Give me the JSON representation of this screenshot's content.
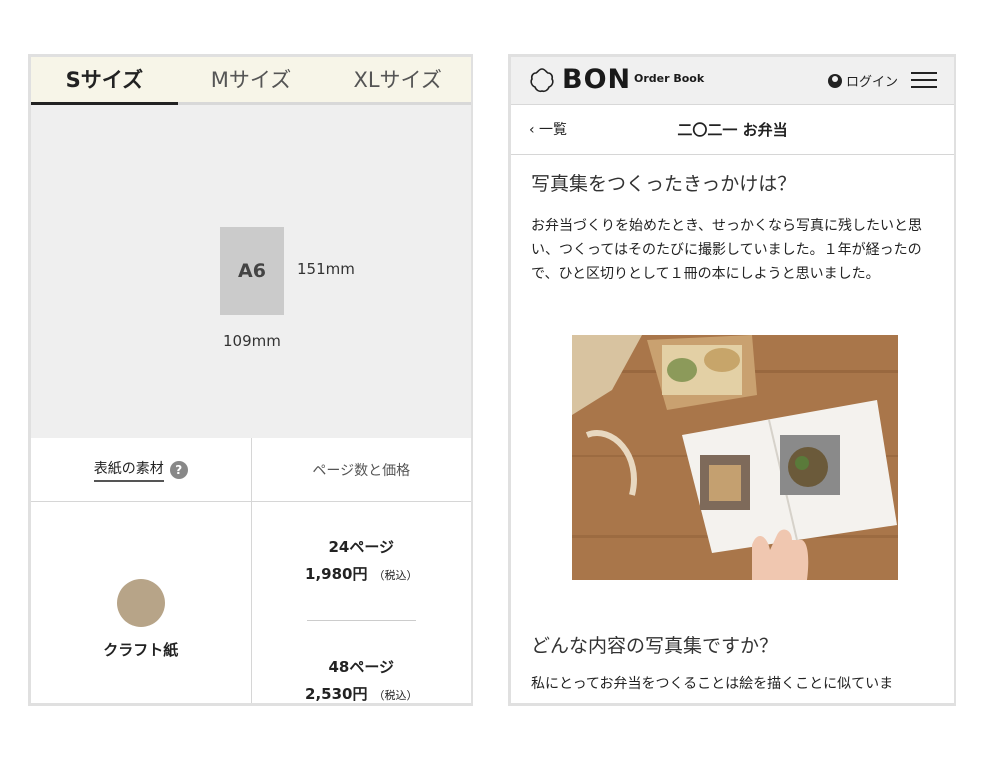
{
  "size_panel": {
    "tabs": [
      {
        "label": "Sサイズ",
        "active": true
      },
      {
        "label": "Mサイズ",
        "active": false
      },
      {
        "label": "XLサイズ",
        "active": false
      }
    ],
    "book_format": "A6",
    "height_label": "151mm",
    "width_label": "109mm",
    "cover_material_header": "表紙の素材",
    "help_icon": "?",
    "price_header": "ページ数と価格",
    "material": {
      "name": "クラフト紙",
      "color": "#b7a488"
    },
    "prices": [
      {
        "pages": "24ページ",
        "amount": "1,980円",
        "tax": "（税込）"
      },
      {
        "pages": "48ページ",
        "amount": "2,530円",
        "tax": "（税込）"
      }
    ]
  },
  "article_panel": {
    "logo_text": "BON",
    "logo_sub": "Order Book",
    "login_label": "ログイン",
    "back_label": "‹ 一覧",
    "page_title": "二〇二一 お弁当",
    "q1": "写真集をつくったきっかけは？",
    "a1": "お弁当づくりを始めたとき、せっかくなら写真に残したいと思い、つくってはそのたびに撮影していました。１年が経ったので、ひと区切りとして１冊の本にしようと思いました。",
    "q2": "どんな内容の写真集ですか？",
    "a2": "私にとってお弁当をつくることは絵を描くことに似ていま"
  },
  "colors": {
    "tab_bg": "#f7f5e8",
    "preview_bg": "#efefef",
    "header_bg": "#f0f0f0"
  }
}
